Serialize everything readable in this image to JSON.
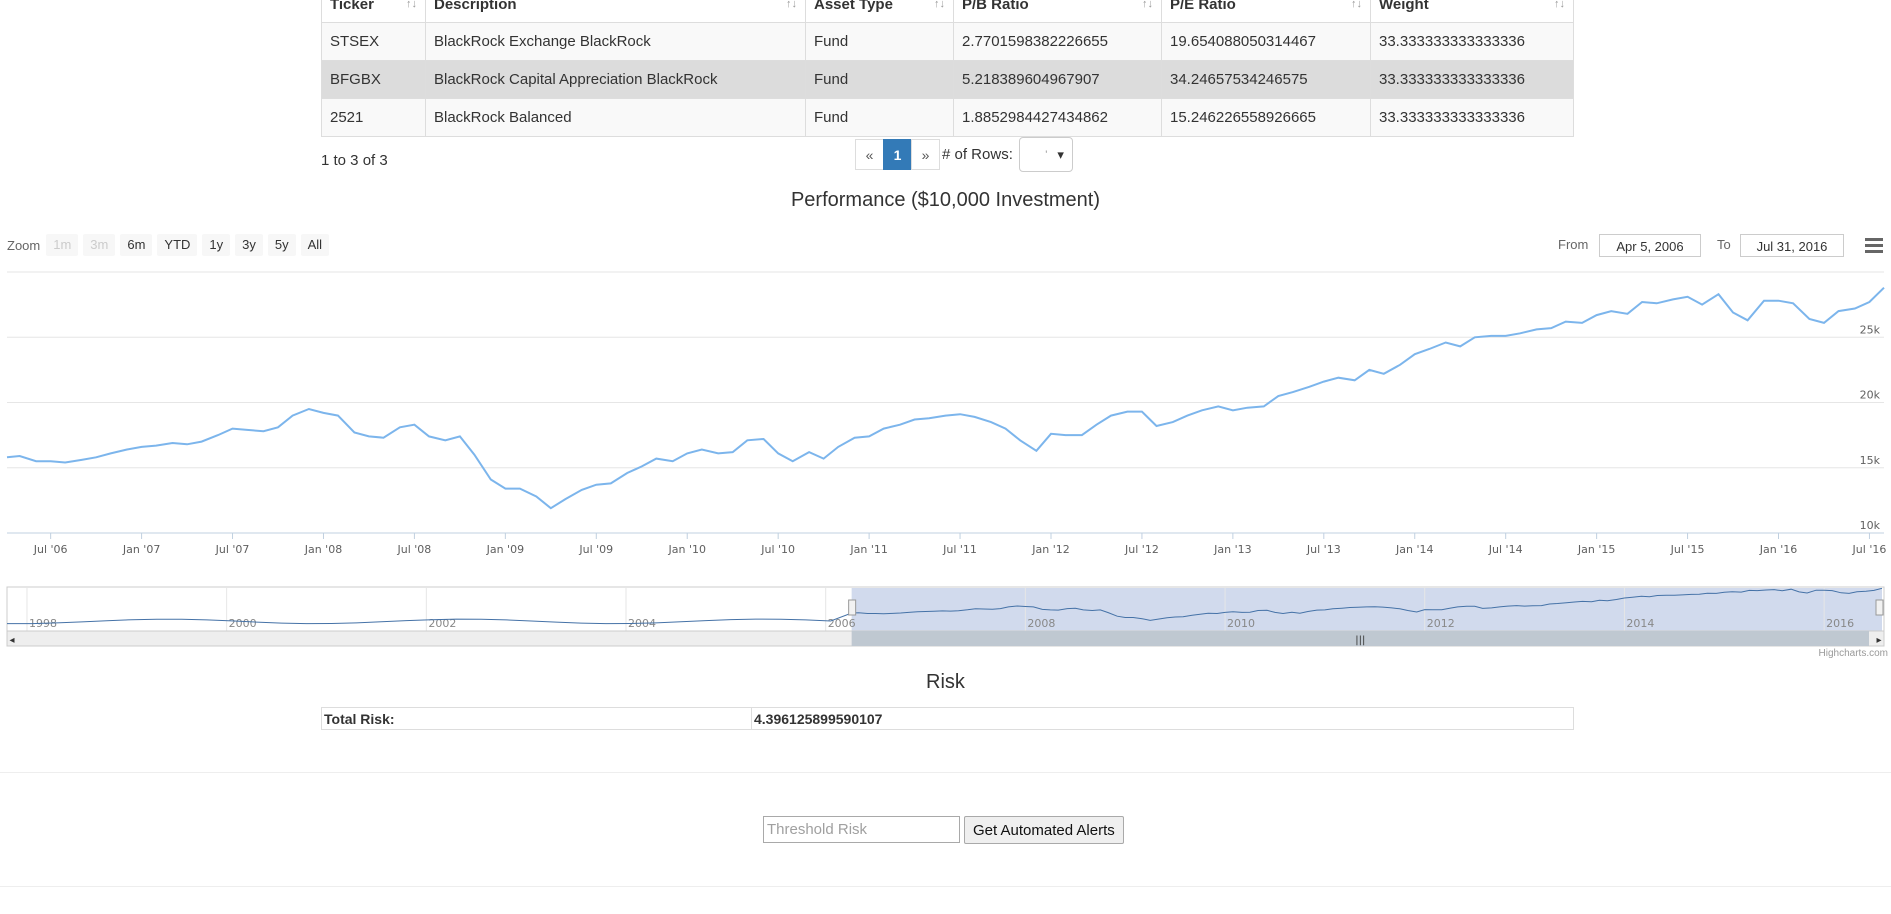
{
  "holdings": {
    "columns": [
      "Ticker",
      "Description",
      "Asset Type",
      "P/B Ratio",
      "P/E Ratio",
      "Weight"
    ],
    "rows": [
      [
        "STSEX",
        "BlackRock Exchange BlackRock",
        "Fund",
        "2.7701598382226655",
        "19.654088050314467",
        "33.333333333333336"
      ],
      [
        "BFGBX",
        "BlackRock Capital Appreciation BlackRock",
        "Fund",
        "5.218389604967907",
        "34.24657534246575",
        "33.333333333333336"
      ],
      [
        "2521",
        "BlackRock Balanced",
        "Fund",
        "1.8852984427434862",
        "15.246226558926665",
        "33.333333333333336"
      ]
    ],
    "sort_glyph": "↑↓"
  },
  "table_info": "1 to 3 of 3",
  "pagination": {
    "prev": "«",
    "current": "1",
    "next": "»",
    "rows_label": "# of Rows:",
    "rows_value": "'",
    "caret": "▾"
  },
  "chart": {
    "zoom_label": "Zoom",
    "zoom_buttons": [
      "1m",
      "3m",
      "6m",
      "YTD",
      "1y",
      "3y",
      "5y",
      "All"
    ],
    "from_label": "From",
    "from_value": "Apr 5, 2006",
    "to_label": "To",
    "to_value": "Jul 31, 2016",
    "credit": "Highcharts.com"
  },
  "chart_data": {
    "type": "line",
    "title": "Performance ($10,000 Investment)",
    "line_color": "#7cb5ec",
    "ylim": [
      10000,
      30000
    ],
    "y_ticks": [
      10000,
      15000,
      20000,
      25000
    ],
    "y_tick_labels": [
      "10k",
      "15k",
      "20k",
      "25k"
    ],
    "x_tick_labels": [
      "Jul '06",
      "Jan '07",
      "Jul '07",
      "Jan '08",
      "Jul '08",
      "Jan '09",
      "Jul '09",
      "Jan '10",
      "Jul '10",
      "Jan '11",
      "Jul '11",
      "Jan '12",
      "Jul '12",
      "Jan '13",
      "Jul '13",
      "Jan '14",
      "Jul '14",
      "Jan '15",
      "Jul '15",
      "Jan '16",
      "Jul '16"
    ],
    "x_tick_years": [
      2006.5,
      2007,
      2007.5,
      2008,
      2008.5,
      2009,
      2009.5,
      2010,
      2010.5,
      2011,
      2011.5,
      2012,
      2012.5,
      2013,
      2013.5,
      2014,
      2014.5,
      2015,
      2015.5,
      2016,
      2016.5
    ],
    "xlim": [
      2006.26,
      2016.58
    ],
    "series": [
      {
        "x": [
          2006.26,
          2006.33,
          2006.42,
          2006.5,
          2006.58,
          2006.67,
          2006.75,
          2006.83,
          2006.92,
          2007.0,
          2007.08,
          2007.17,
          2007.25,
          2007.33,
          2007.42,
          2007.5,
          2007.58,
          2007.67,
          2007.75,
          2007.83,
          2007.92,
          2008.0,
          2008.08,
          2008.17,
          2008.25,
          2008.33,
          2008.42,
          2008.5,
          2008.58,
          2008.67,
          2008.75,
          2008.83,
          2008.92,
          2009.0,
          2009.08,
          2009.17,
          2009.25,
          2009.33,
          2009.42,
          2009.5,
          2009.58,
          2009.67,
          2009.75,
          2009.83,
          2009.92,
          2010.0,
          2010.08,
          2010.17,
          2010.25,
          2010.33,
          2010.42,
          2010.5,
          2010.58,
          2010.67,
          2010.75,
          2010.83,
          2010.92,
          2011.0,
          2011.08,
          2011.17,
          2011.25,
          2011.33,
          2011.42,
          2011.5,
          2011.58,
          2011.67,
          2011.75,
          2011.83,
          2011.92,
          2012.0,
          2012.08,
          2012.17,
          2012.25,
          2012.33,
          2012.42,
          2012.5,
          2012.58,
          2012.67,
          2012.75,
          2012.83,
          2012.92,
          2013.0,
          2013.08,
          2013.17,
          2013.25,
          2013.33,
          2013.42,
          2013.5,
          2013.58,
          2013.67,
          2013.75,
          2013.83,
          2013.92,
          2014.0,
          2014.08,
          2014.17,
          2014.25,
          2014.33,
          2014.42,
          2014.5,
          2014.58,
          2014.67,
          2014.75,
          2014.83,
          2014.92,
          2015.0,
          2015.08,
          2015.17,
          2015.25,
          2015.33,
          2015.42,
          2015.5,
          2015.58,
          2015.67,
          2015.75,
          2015.83,
          2015.92,
          2016.0,
          2016.08,
          2016.17,
          2016.25,
          2016.33,
          2016.42,
          2016.5,
          2016.58
        ],
        "values": [
          15800,
          15900,
          15500,
          15500,
          15400,
          15600,
          15800,
          16100,
          16400,
          16600,
          16700,
          16900,
          16800,
          17000,
          17500,
          18000,
          17900,
          17800,
          18100,
          19000,
          19500,
          19200,
          19000,
          17700,
          17400,
          17300,
          18100,
          18300,
          17400,
          17100,
          17400,
          16000,
          14100,
          13400,
          13400,
          12800,
          11900,
          12600,
          13300,
          13700,
          13800,
          14600,
          15100,
          15700,
          15500,
          16100,
          16400,
          16100,
          16200,
          17100,
          17200,
          16100,
          15500,
          16200,
          15700,
          16600,
          17300,
          17400,
          18000,
          18300,
          18700,
          18800,
          19000,
          19100,
          18900,
          18500,
          18000,
          17100,
          16300,
          17600,
          17500,
          17500,
          18300,
          19000,
          19300,
          19300,
          18200,
          18500,
          19000,
          19400,
          19700,
          19400,
          19600,
          19700,
          20500,
          20800,
          21200,
          21600,
          21900,
          21700,
          22500,
          22200,
          22900,
          23700,
          24100,
          24600,
          24300,
          25000,
          25100,
          25100,
          25300,
          25600,
          25700,
          26200,
          26100,
          26700,
          27000,
          26800,
          27700,
          27600,
          27900,
          28100,
          27500,
          28300,
          26900,
          26300,
          27800,
          27800,
          27600,
          26400,
          26100,
          27000,
          27200,
          27700,
          28800
        ]
      }
    ],
    "navigator": {
      "year_labels": [
        "1998",
        "2000",
        "2002",
        "2004",
        "2006",
        "2008",
        "2010",
        "2012",
        "2014",
        "2016"
      ],
      "year_ticks": [
        1998,
        2000,
        2002,
        2004,
        2006,
        2008,
        2010,
        2012,
        2014,
        2016
      ],
      "xlim": [
        1997.8,
        2016.6
      ],
      "selected_range": [
        2006.26,
        2016.58
      ]
    }
  },
  "risk": {
    "title": "Risk",
    "label": "Total Risk:",
    "value": "4.396125899590107"
  },
  "alerts": {
    "placeholder": "Threshold Risk",
    "button_label": "Get Automated Alerts"
  }
}
